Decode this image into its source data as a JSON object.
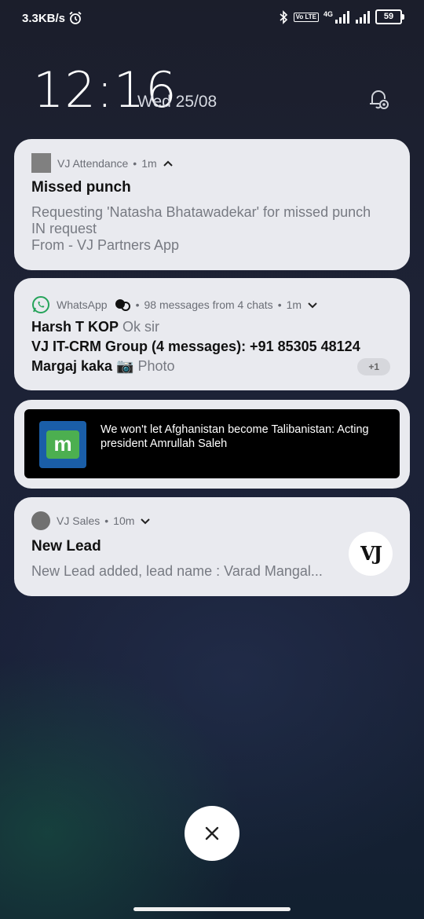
{
  "statusbar": {
    "speed": "3.3KB/s",
    "network": "4G",
    "volte": "Vo LTE",
    "battery": "59",
    "icons": [
      "alarm-icon",
      "bluetooth-icon",
      "signal-icon",
      "battery-icon"
    ]
  },
  "lockscreen": {
    "time": "12:16",
    "date": "Wed 25/08"
  },
  "notifications": {
    "attendance": {
      "app": "VJ Attendance",
      "time": "1m",
      "title": "Missed punch",
      "body_line1": "Requesting 'Natasha Bhatawadekar' for missed punch",
      "body_line2": "IN request",
      "body_line3": "From - VJ Partners App"
    },
    "whatsapp": {
      "app": "WhatsApp",
      "summary": "98 messages from 4 chats",
      "time": "1m",
      "line1_sender": "Harsh T KOP",
      "line1_msg": "Ok sir",
      "line2_sender": "VJ IT-CRM Group (4 messages): +91 85305 48124",
      "line3_sender": "Margaj kaka",
      "line3_msg": "📷 Photo",
      "more": "+1"
    },
    "news": {
      "logo_letter": "m",
      "headline": "We won't let Afghanistan become Talibanistan: Acting president Amrullah Saleh"
    },
    "sales": {
      "app": "VJ Sales",
      "time": "10m",
      "title": "New Lead",
      "body": "New Lead added, lead name : Varad Mangal...",
      "avatar_text": "VJ"
    }
  },
  "colors": {
    "card_bg": "#e9eaef",
    "whatsapp_green": "#25d366",
    "news_blue": "#1a5ea8"
  }
}
